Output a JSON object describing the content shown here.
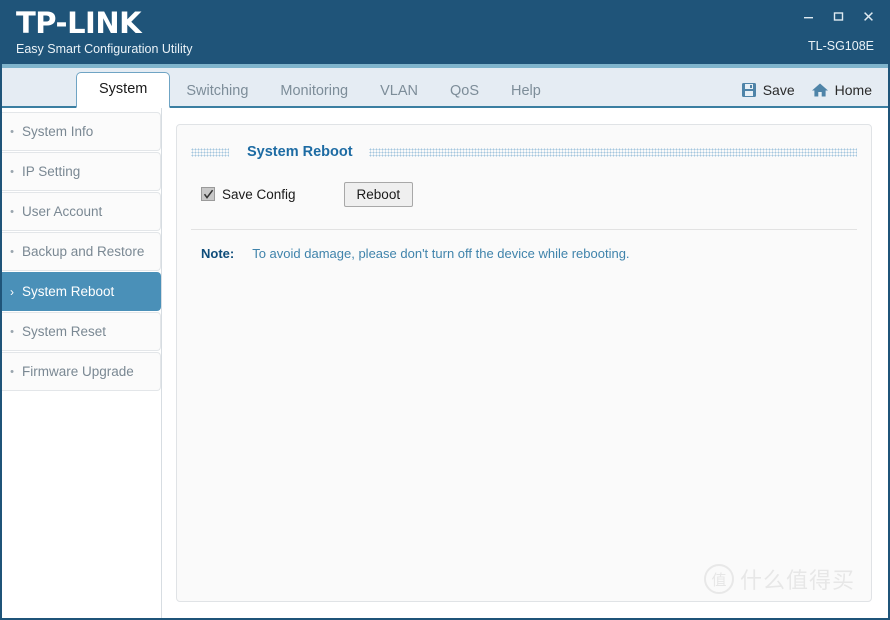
{
  "window": {
    "brand_name": "TP-LINK",
    "brand_subtitle": "Easy Smart Configuration Utility",
    "model": "TL-SG108E",
    "controls": {
      "minimize_label": "minimize",
      "maximize_label": "maximize",
      "close_label": "close"
    },
    "colors": {
      "header_blue": "#1f5479",
      "accent_line": "#7fb4cc",
      "nav_background": "#e5ecf3",
      "nav_underline": "#3b7ea1",
      "active_item": "#4a90b8",
      "section_title": "#1d6ba3",
      "note_label": "#0f4d7a",
      "note_text": "#3f83ab"
    }
  },
  "nav": {
    "tabs": [
      {
        "label": "System",
        "active": true
      },
      {
        "label": "Switching",
        "active": false
      },
      {
        "label": "Monitoring",
        "active": false
      },
      {
        "label": "VLAN",
        "active": false
      },
      {
        "label": "QoS",
        "active": false
      },
      {
        "label": "Help",
        "active": false
      }
    ],
    "actions": [
      {
        "label": "Save",
        "icon": "save-icon"
      },
      {
        "label": "Home",
        "icon": "home-icon"
      }
    ]
  },
  "sidebar": {
    "items": [
      {
        "label": "System Info",
        "marker": "•",
        "active": false
      },
      {
        "label": "IP Setting",
        "marker": "•",
        "active": false
      },
      {
        "label": "User Account",
        "marker": "•",
        "active": false
      },
      {
        "label": "Backup and Restore",
        "marker": "•",
        "active": false
      },
      {
        "label": "System Reboot",
        "marker": "›",
        "active": true
      },
      {
        "label": "System Reset",
        "marker": "•",
        "active": false
      },
      {
        "label": "Firmware Upgrade",
        "marker": "•",
        "active": false
      }
    ]
  },
  "main": {
    "section_title": "System Reboot",
    "save_config": {
      "label": "Save Config",
      "checked": true
    },
    "reboot_button": "Reboot",
    "note": {
      "label": "Note:",
      "text": "To avoid damage, please don't turn off the device while rebooting."
    }
  },
  "watermark": {
    "badge": "值",
    "text": "什么值得买"
  }
}
